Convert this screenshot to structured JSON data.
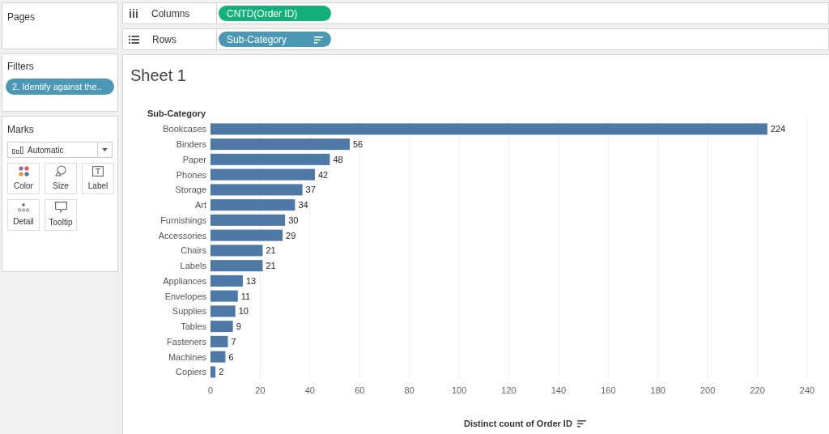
{
  "pages_card": {
    "title": "Pages"
  },
  "filters_card": {
    "title": "Filters",
    "pills": [
      {
        "label": "2. Identify against the.."
      }
    ]
  },
  "marks_card": {
    "title": "Marks",
    "mark_type": "Automatic",
    "buttons": [
      {
        "label": "Color",
        "kind": "color"
      },
      {
        "label": "Size",
        "kind": "size"
      },
      {
        "label": "Label",
        "kind": "label"
      },
      {
        "label": "Detail",
        "kind": "detail"
      },
      {
        "label": "Tooltip",
        "kind": "tooltip"
      }
    ]
  },
  "shelves": [
    {
      "label": "Columns",
      "kind": "columns",
      "pill": "CNTD(Order ID)",
      "color": "#13b07c",
      "sorted": false
    },
    {
      "label": "Rows",
      "kind": "rows",
      "pill": "Sub-Category",
      "color": "#4b97b4",
      "sorted": true
    }
  ],
  "sheet": {
    "title": "Sheet 1",
    "chart_data": {
      "type": "bar",
      "orientation": "horizontal",
      "ylabel": "Sub-Category",
      "xlabel": "Distinct count of Order ID",
      "categories": [
        "Bookcases",
        "Binders",
        "Paper",
        "Phones",
        "Storage",
        "Art",
        "Furnishings",
        "Accessories",
        "Chairs",
        "Labels",
        "Appliances",
        "Envelopes",
        "Supplies",
        "Tables",
        "Fasteners",
        "Machines",
        "Copiers"
      ],
      "series": [
        {
          "color": "#4e79a7",
          "values": [
            224,
            56,
            48,
            42,
            37,
            34,
            30,
            29,
            21,
            21,
            13,
            11,
            10,
            9,
            7,
            6,
            2
          ]
        }
      ],
      "xticks": [
        0,
        20,
        40,
        60,
        80,
        100,
        120,
        140,
        160,
        180,
        200,
        220,
        240
      ],
      "xlim": [
        0,
        240
      ],
      "grid": true,
      "data_labels": true
    }
  }
}
